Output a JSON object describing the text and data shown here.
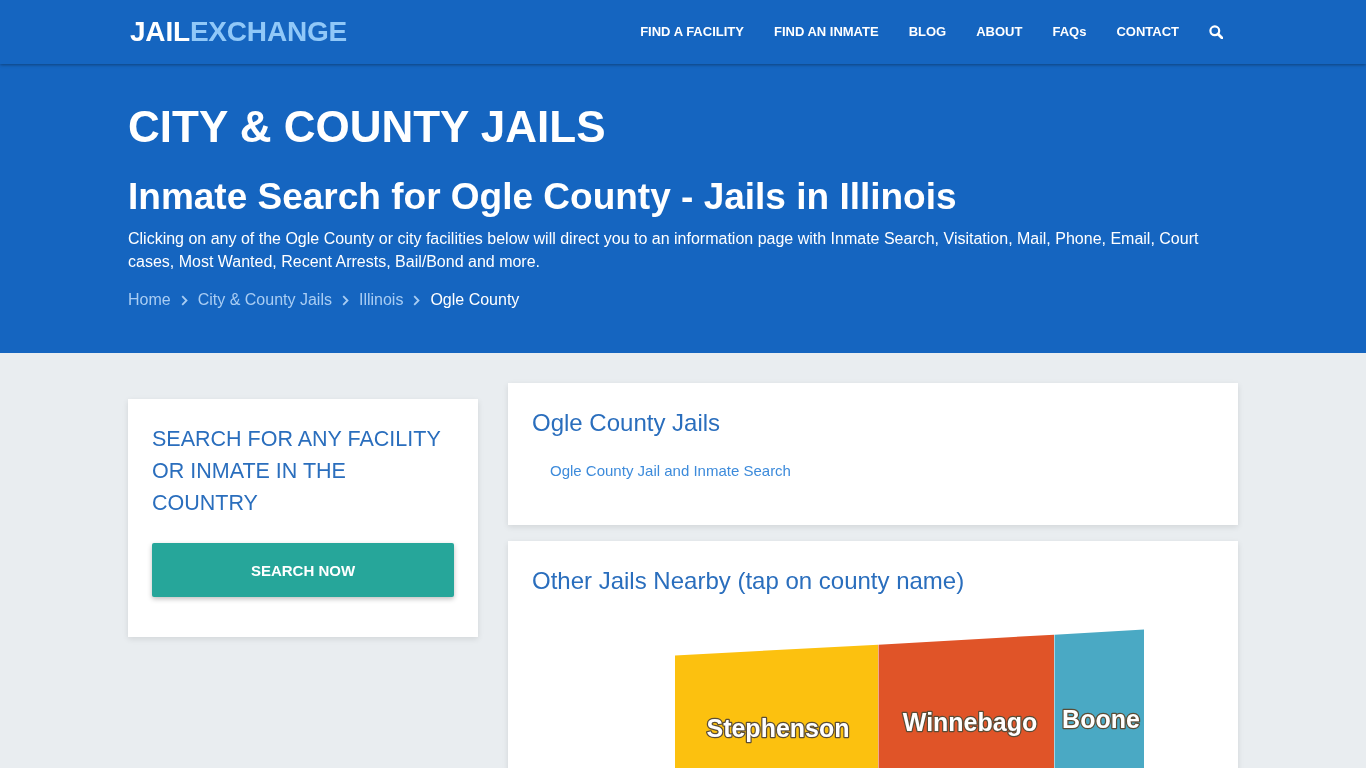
{
  "header": {
    "logo": {
      "primary": "JAIL",
      "accent": "EXCHANGE"
    },
    "nav": [
      "FIND A FACILITY",
      "FIND AN INMATE",
      "BLOG",
      "ABOUT",
      "FAQs",
      "CONTACT"
    ]
  },
  "hero": {
    "title": "CITY & COUNTY JAILS",
    "subtitle": "Inmate Search for Ogle County - Jails in Illinois",
    "description": "Clicking on any of the Ogle County or city facilities below will direct you to an information page with Inmate Search, Visitation, Mail, Phone, Email, Court cases, Most Wanted, Recent Arrests, Bail/Bond and more.",
    "breadcrumbs": [
      {
        "label": "Home",
        "current": false
      },
      {
        "label": "City & County Jails",
        "current": false
      },
      {
        "label": "Illinois",
        "current": false
      },
      {
        "label": "Ogle County",
        "current": true
      }
    ]
  },
  "search_card": {
    "heading": "SEARCH FOR ANY FACILITY OR INMATE IN THE COUNTRY",
    "button": "SEARCH NOW"
  },
  "county_jails": {
    "heading": "Ogle County Jails",
    "links": [
      "Ogle County Jail and Inmate Search"
    ]
  },
  "nearby": {
    "heading": "Other Jails Nearby (tap on county name)",
    "counties": [
      {
        "name": "Stephenson",
        "color": "#fcc10f"
      },
      {
        "name": "Winnebago",
        "color": "#e05428"
      },
      {
        "name": "Boone",
        "color": "#4aa9c4"
      }
    ]
  }
}
